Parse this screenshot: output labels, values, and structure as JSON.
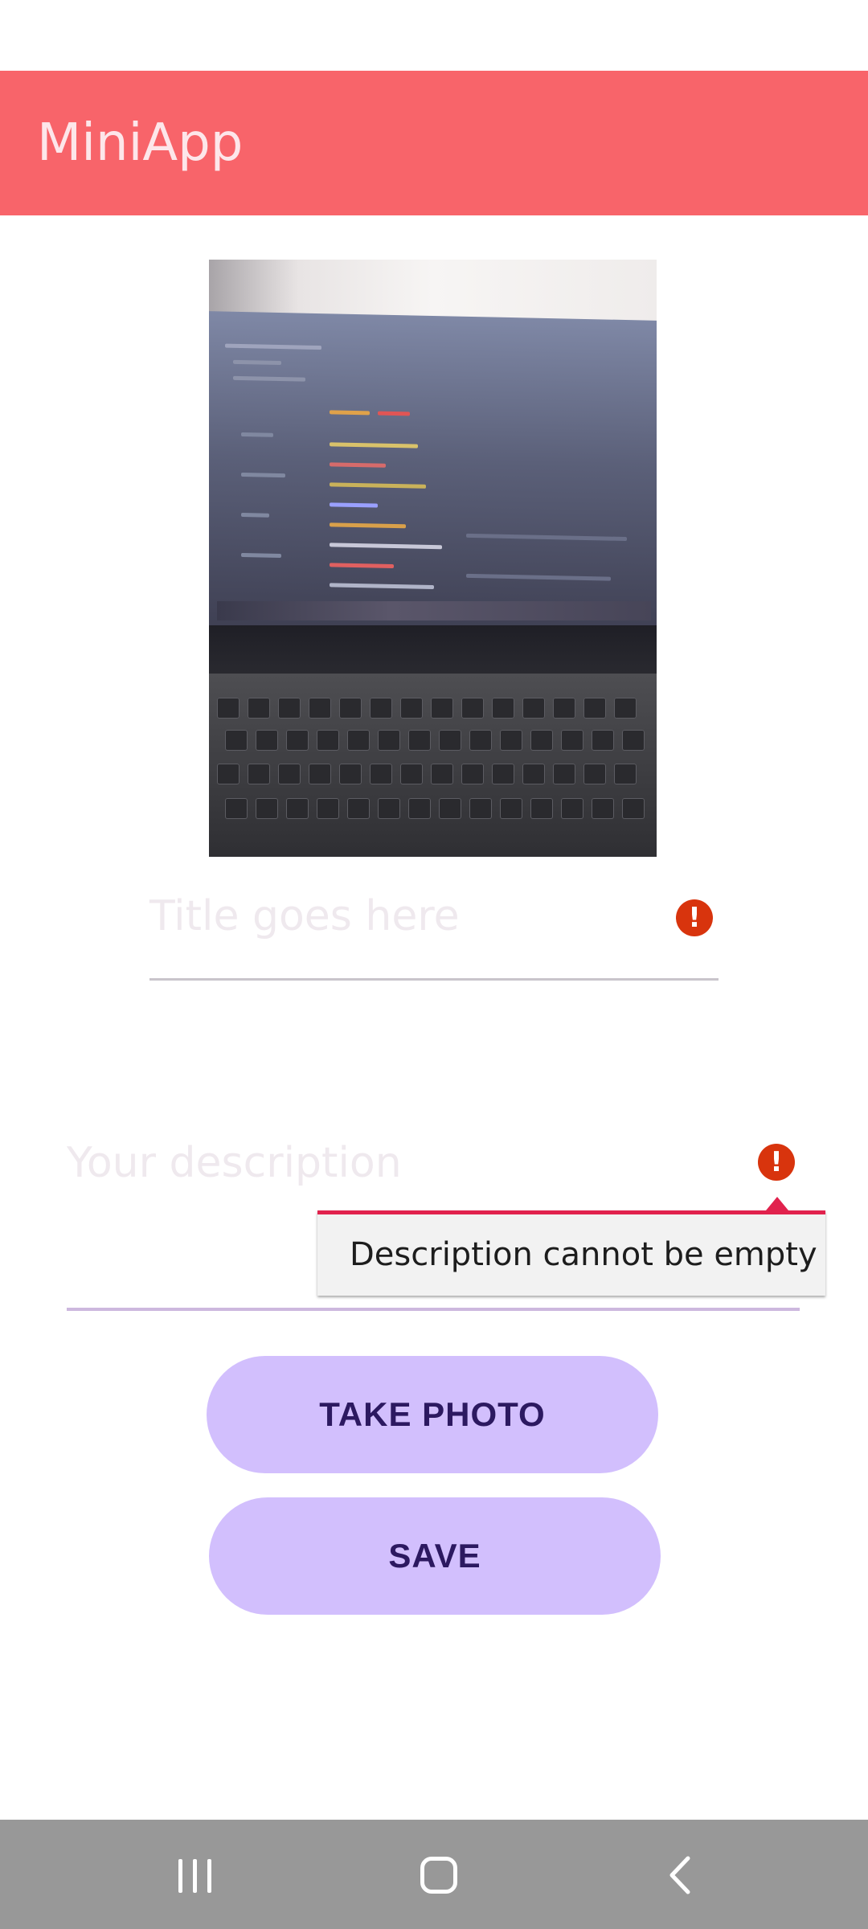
{
  "app_bar": {
    "title": "MiniApp",
    "color": "#f8646a"
  },
  "photo": {
    "alt": "captured photo"
  },
  "form": {
    "title_placeholder": "Title goes here",
    "description_placeholder": "Your description",
    "description_error": "Description cannot be empty",
    "error_icon": "!"
  },
  "buttons": {
    "take_photo": "TAKE PHOTO",
    "save": "SAVE",
    "color": "#d2bffd"
  },
  "nav": {
    "recent_icon": "recent-apps-icon",
    "home_icon": "home-icon",
    "back_icon": "back-icon"
  }
}
